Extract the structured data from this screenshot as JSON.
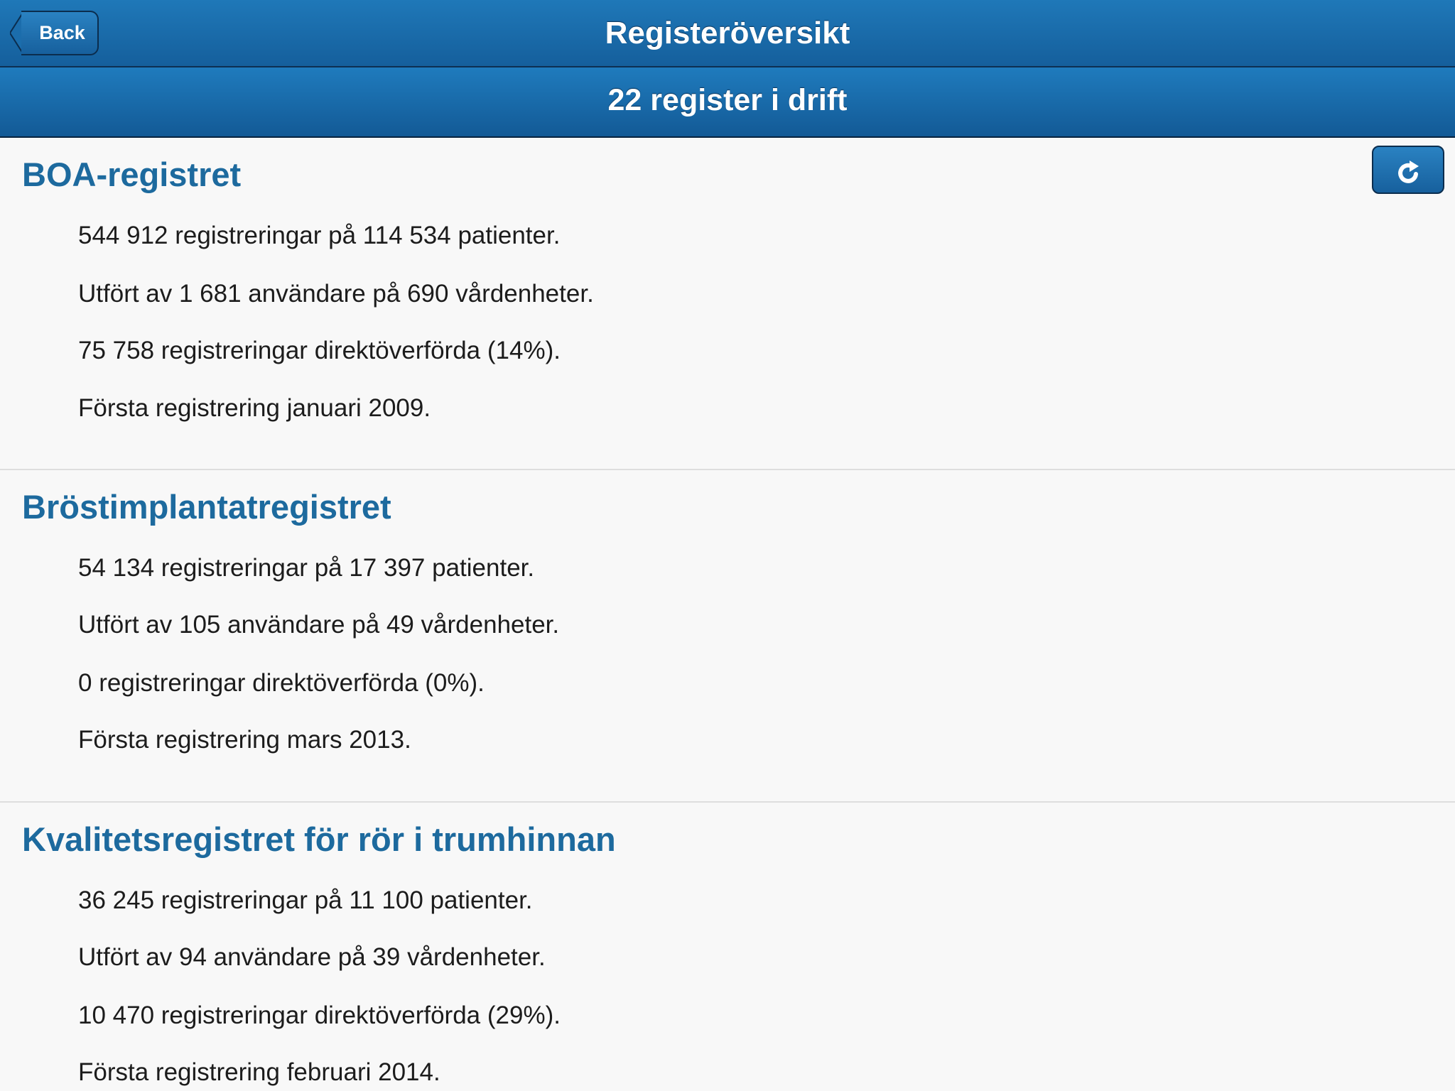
{
  "header": {
    "title": "Registeröversikt",
    "back_label": "Back"
  },
  "subheader": {
    "title": "22 register i drift"
  },
  "registers": [
    {
      "name": "BOA-registret",
      "stats": [
        "544 912 registreringar på 114 534 patienter.",
        "Utfört av 1 681 användare på 690 vårdenheter.",
        "75 758 registreringar direktöverförda (14%).",
        "Första registrering januari 2009."
      ]
    },
    {
      "name": "Bröstimplantatregistret",
      "stats": [
        "54 134 registreringar på 17 397 patienter.",
        "Utfört av 105 användare på 49 vårdenheter.",
        "0 registreringar direktöverförda (0%).",
        "Första registrering mars 2013."
      ]
    },
    {
      "name": "Kvalitetsregistret för rör i trumhinnan",
      "stats": [
        "36 245 registreringar på 11 100 patienter.",
        "Utfört av 94 användare på 39 vårdenheter.",
        "10 470 registreringar direktöverförda (29%).",
        "Första registrering februari 2014."
      ]
    }
  ],
  "icons": {
    "back": "back-arrow-icon",
    "refresh": "refresh-icon"
  },
  "colors": {
    "header_blue": "#1f78b8",
    "register_title": "#1d6a9e",
    "background": "#f8f8f8"
  }
}
